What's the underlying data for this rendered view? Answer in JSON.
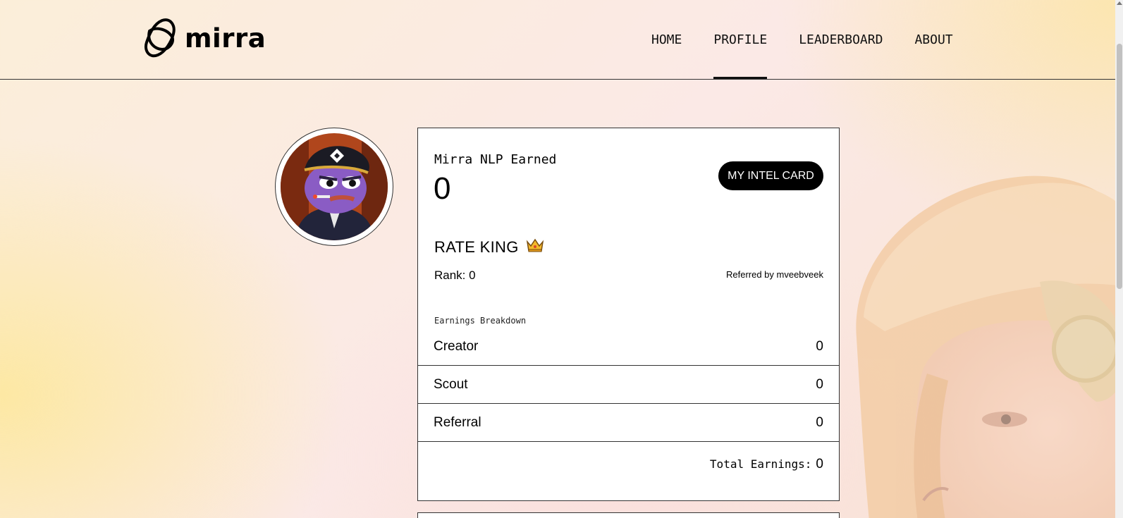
{
  "header": {
    "brand": "mirra",
    "nav": [
      {
        "label": "HOME",
        "active": false
      },
      {
        "label": "PROFILE",
        "active": true
      },
      {
        "label": "LEADERBOARD",
        "active": false
      },
      {
        "label": "ABOUT",
        "active": false
      }
    ]
  },
  "profile": {
    "nlp_label": "Mirra NLP Earned",
    "nlp_value": "0",
    "intel_button": "MY INTEL CARD",
    "title": "RATE KING",
    "title_icon": "crown-icon",
    "rank_text": "Rank: 0",
    "referred_text": "Referred by mveebveek",
    "breakdown_label": "Earnings Breakdown",
    "breakdown": [
      {
        "label": "Creator",
        "value": "0"
      },
      {
        "label": "Scout",
        "value": "0"
      },
      {
        "label": "Referral",
        "value": "0"
      }
    ],
    "total_label": "Total Earnings:",
    "total_value": "0"
  },
  "colors": {
    "accent": "#000000",
    "card_bg": "#ffffff",
    "avatar_purple": "#8a5cc4"
  }
}
